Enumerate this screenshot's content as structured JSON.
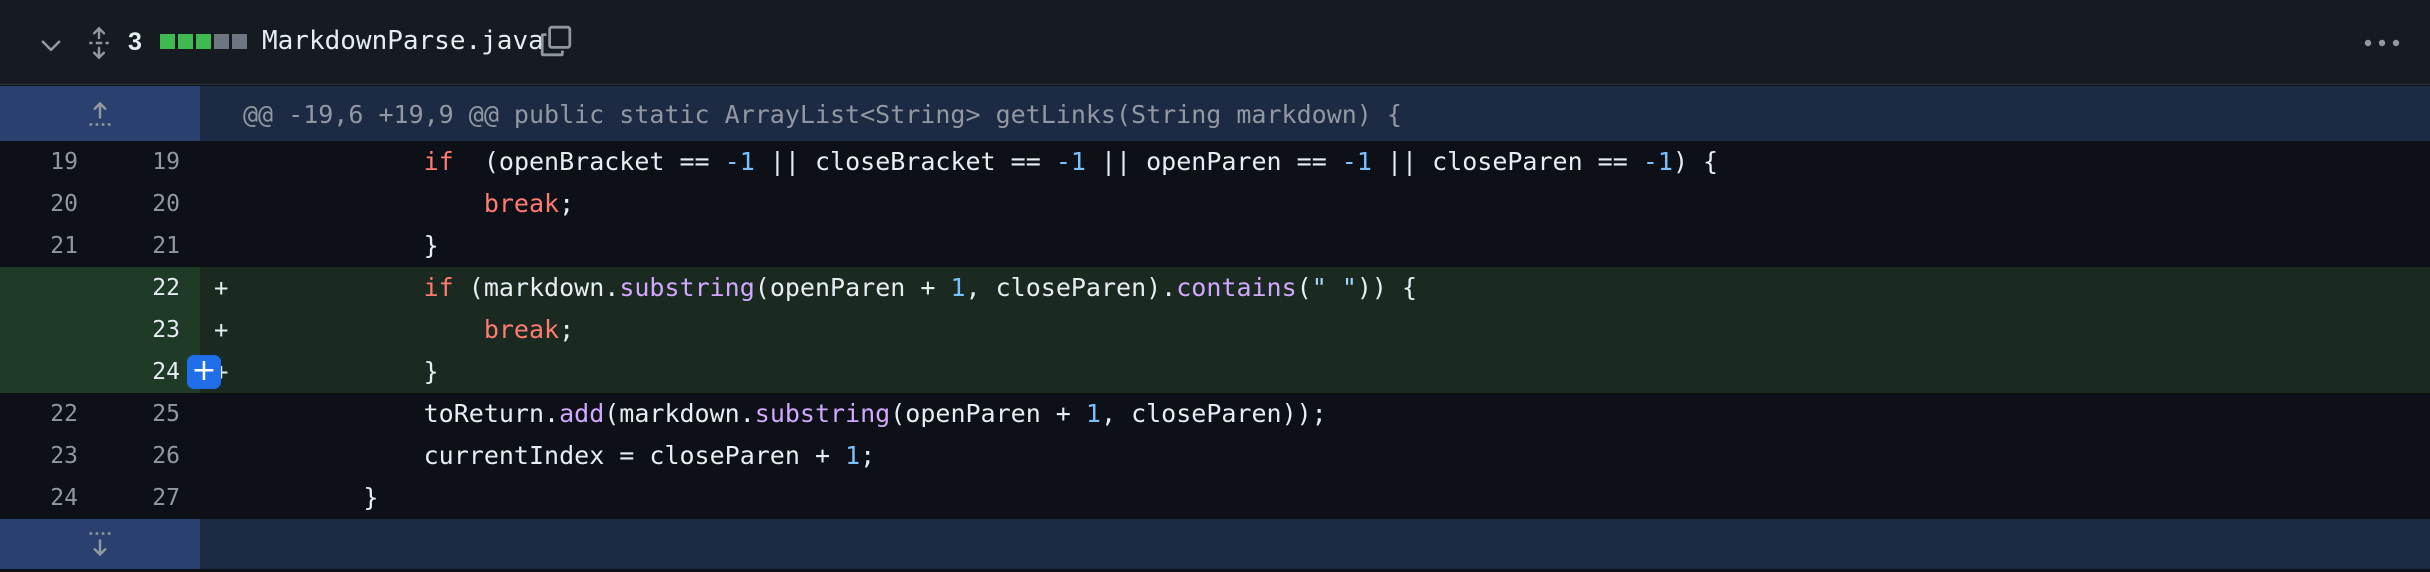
{
  "header": {
    "change_count": "3",
    "filename": "MarkdownParse.java",
    "diffstat_colors": [
      "#3fb950",
      "#3fb950",
      "#3fb950",
      "#6e7681",
      "#6e7681"
    ],
    "icons": [
      "chevron-down-icon",
      "unfold-icon",
      "copy-icon",
      "kebab-horizontal-icon"
    ]
  },
  "hunk": {
    "header_text": "@@ -19,6 +19,9 @@ public static ArrayList<String> getLinks(String markdown) {",
    "icons": [
      "expand-up-icon",
      "expand-down-icon"
    ]
  },
  "lines": [
    {
      "type": "context",
      "old": "19",
      "new": "19",
      "marker": "",
      "indent": "            ",
      "tokens": [
        [
          "kw",
          "if"
        ],
        [
          "",
          "  (openBracket == "
        ],
        [
          "num",
          "-1"
        ],
        [
          "",
          " || closeBracket == "
        ],
        [
          "num",
          "-1"
        ],
        [
          "",
          " || openParen == "
        ],
        [
          "num",
          "-1"
        ],
        [
          "",
          " || closeParen == "
        ],
        [
          "num",
          "-1"
        ],
        [
          "",
          ") {"
        ]
      ]
    },
    {
      "type": "context",
      "old": "20",
      "new": "20",
      "marker": "",
      "indent": "                ",
      "tokens": [
        [
          "kw",
          "break"
        ],
        [
          "",
          ";"
        ]
      ]
    },
    {
      "type": "context",
      "old": "21",
      "new": "21",
      "marker": "",
      "indent": "            ",
      "tokens": [
        [
          "",
          "}"
        ]
      ]
    },
    {
      "type": "add",
      "old": "",
      "new": "22",
      "marker": "+",
      "indent": "            ",
      "tokens": [
        [
          "kw",
          "if"
        ],
        [
          "",
          " (markdown."
        ],
        [
          "fn",
          "substring"
        ],
        [
          "",
          "(openParen + "
        ],
        [
          "num",
          "1"
        ],
        [
          "",
          ", closeParen)."
        ],
        [
          "fn",
          "contains"
        ],
        [
          "",
          "("
        ],
        [
          "str",
          "\" \""
        ],
        [
          "",
          ")) {"
        ]
      ]
    },
    {
      "type": "add",
      "old": "",
      "new": "23",
      "marker": "+",
      "indent": "                ",
      "tokens": [
        [
          "kw",
          "break"
        ],
        [
          "",
          ";"
        ]
      ]
    },
    {
      "type": "add",
      "old": "",
      "new": "24",
      "marker": "+",
      "indent": "            ",
      "tokens": [
        [
          "",
          "}"
        ]
      ],
      "has_comment_button": true
    },
    {
      "type": "context",
      "old": "22",
      "new": "25",
      "marker": "",
      "indent": "            ",
      "tokens": [
        [
          "",
          "toReturn."
        ],
        [
          "fn",
          "add"
        ],
        [
          "",
          "(markdown."
        ],
        [
          "fn",
          "substring"
        ],
        [
          "",
          "(openParen + "
        ],
        [
          "num",
          "1"
        ],
        [
          "",
          ", closeParen));"
        ]
      ]
    },
    {
      "type": "context",
      "old": "23",
      "new": "26",
      "marker": "",
      "indent": "            ",
      "tokens": [
        [
          "",
          "currentIndex = closeParen + "
        ],
        [
          "num",
          "1"
        ],
        [
          "",
          ";"
        ]
      ]
    },
    {
      "type": "context",
      "old": "24",
      "new": "27",
      "marker": "",
      "indent": "        ",
      "tokens": [
        [
          "",
          "}"
        ]
      ]
    }
  ],
  "comment_button_label": "+"
}
